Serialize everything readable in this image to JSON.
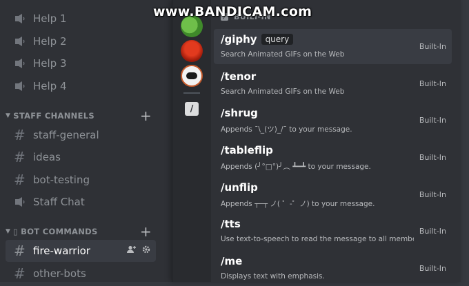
{
  "sidebar": {
    "channels_top": [
      {
        "label": "Help 1",
        "icon": "voice-channel-icon"
      },
      {
        "label": "Help 2",
        "icon": "voice-channel-icon"
      },
      {
        "label": "Help 3",
        "icon": "voice-channel-icon"
      },
      {
        "label": "Help 4",
        "icon": "voice-channel-icon"
      }
    ],
    "staff_category": "STAFF CHANNELS",
    "staff_channels": [
      {
        "label": "staff-general",
        "icon": "text-channel-icon"
      },
      {
        "label": "ideas",
        "icon": "text-channel-icon"
      },
      {
        "label": "bot-testing",
        "icon": "text-channel-icon"
      },
      {
        "label": "Staff Chat",
        "icon": "voice-channel-icon"
      }
    ],
    "bot_category": "▯ BOT COMMANDS",
    "bot_channels": [
      {
        "label": "fire-warrior",
        "icon": "text-channel-icon",
        "active": true
      },
      {
        "label": "other-bots",
        "icon": "text-channel-icon"
      }
    ]
  },
  "popup": {
    "section_title": "BUILT-IN",
    "commands": [
      {
        "name": "/giphy",
        "param": "query",
        "desc": "Search Animated GIFs on the Web",
        "source": "Built-In",
        "selected": true
      },
      {
        "name": "/tenor",
        "param": "",
        "desc": "Search Animated GIFs on the Web",
        "source": "Built-In"
      },
      {
        "name": "/shrug",
        "param": "",
        "desc": "Appends ¯\\_(ツ)_/¯ to your message.",
        "source": "Built-In"
      },
      {
        "name": "/tableflip",
        "param": "",
        "desc": "Appends (╯°□°)╯︵ ┻━┻ to your message.",
        "source": "Built-In"
      },
      {
        "name": "/unflip",
        "param": "",
        "desc": "Appends ┬─┬ ノ( ゜-゜ノ) to your message.",
        "source": "Built-In"
      },
      {
        "name": "/tts",
        "param": "",
        "desc": "Use text-to-speech to read the message to all members ...",
        "source": "Built-In"
      },
      {
        "name": "/me",
        "param": "",
        "desc": "Displays text with emphasis.",
        "source": "Built-In"
      }
    ]
  },
  "watermark": "www.BANDICAM.com",
  "colors": {
    "bg": "#36393f",
    "sidebar": "#2f3136",
    "active": "#393c43"
  }
}
